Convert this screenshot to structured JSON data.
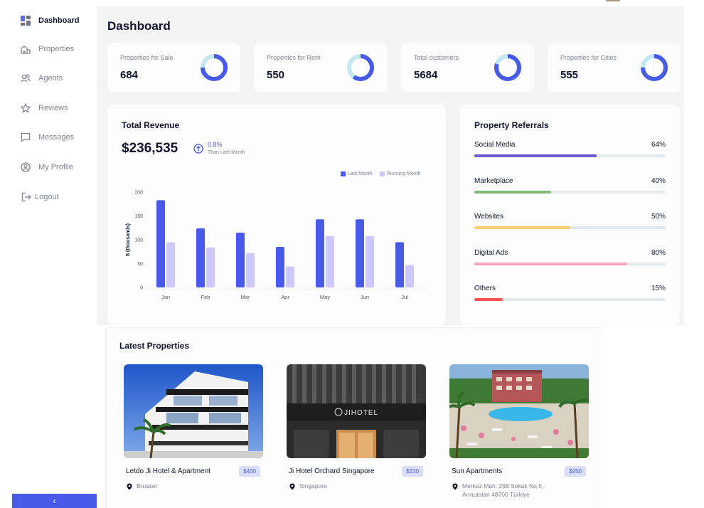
{
  "sidebar": {
    "items": [
      {
        "label": "Dashboard",
        "icon": "dashboard-icon",
        "active": true
      },
      {
        "label": "Properties",
        "icon": "properties-icon"
      },
      {
        "label": "Agents",
        "icon": "agents-icon"
      },
      {
        "label": "Reviews",
        "icon": "star-icon"
      },
      {
        "label": "Messages",
        "icon": "chat-icon"
      },
      {
        "label": "My Profile",
        "icon": "profile-icon"
      },
      {
        "label": "Logout",
        "icon": "logout-icon"
      }
    ],
    "collapse_glyph": "‹"
  },
  "page_title": "Dashboard",
  "stats": [
    {
      "label": "Properties for Sale",
      "value": "684",
      "fraction": 0.75,
      "color": "#475be8",
      "track": "#c4e8ef"
    },
    {
      "label": "Properties for Rent",
      "value": "550",
      "fraction": 0.6,
      "color": "#475be8",
      "track": "#c4e8ef"
    },
    {
      "label": "Total customers",
      "value": "5684",
      "fraction": 0.8,
      "color": "#475be8",
      "track": "#c4e8ef"
    },
    {
      "label": "Properties for Cities",
      "value": "555",
      "fraction": 0.75,
      "color": "#475be8",
      "track": "#c4e8ef"
    }
  ],
  "revenue": {
    "title": "Total Revenue",
    "amount": "$236,535",
    "change": "0.8%",
    "change_sub": "Than Last Month",
    "legend": [
      {
        "name": "Last Month",
        "color": "#475be8"
      },
      {
        "name": "Running Month",
        "color": "#cfc8ff"
      }
    ]
  },
  "chart_data": {
    "type": "bar",
    "categories": [
      "Jan",
      "Feb",
      "Mar",
      "Apr",
      "May",
      "Jun",
      "Jul"
    ],
    "series": [
      {
        "name": "Last Month",
        "values": [
          183,
          124,
          115,
          85,
          143,
          143,
          95
        ],
        "color": "#475be8"
      },
      {
        "name": "Running Month",
        "values": [
          95,
          84,
          72,
          44,
          108,
          108,
          47
        ],
        "color": "#cfc8ff"
      }
    ],
    "ylabel": "$ (thousands)",
    "ylim": [
      0,
      200
    ],
    "yticks": [
      0,
      50,
      100,
      150,
      200
    ]
  },
  "referrals": {
    "title": "Property Referrals",
    "items": [
      {
        "name": "Social Media",
        "pct": "64%",
        "value": 0.64,
        "color": "#6c5dd3"
      },
      {
        "name": "Marketplace",
        "pct": "40%",
        "value": 0.4,
        "color": "#7fba7a"
      },
      {
        "name": "Websites",
        "pct": "50%",
        "value": 0.5,
        "color": "#ffce73"
      },
      {
        "name": "Digital Ads",
        "pct": "80%",
        "value": 0.8,
        "color": "#ffa2c0"
      },
      {
        "name": "Others",
        "pct": "15%",
        "value": 0.15,
        "color": "#f45252"
      }
    ]
  },
  "latest": {
    "title": "Latest Properties",
    "items": [
      {
        "name": "Letdo Ji Hotel & Apartment",
        "price": "$400",
        "location": "Brussel"
      },
      {
        "name": "Ji Hotel Orchard Singapore",
        "price": "$230",
        "location": "Singapore",
        "sign": "JIHOTEL"
      },
      {
        "name": "Sun Apartments",
        "price": "$250",
        "location": "Merkez Mah. 298 Sokak No.5, Armutalan 48700 Türkiye"
      }
    ]
  }
}
